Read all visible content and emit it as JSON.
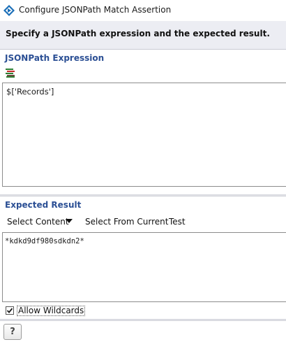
{
  "window": {
    "title": "Configure JSONPath Match Assertion",
    "app_icon": "app-logo-icon"
  },
  "header": {
    "instruction": "Specify a JSONPath expression and the expected result."
  },
  "expression_section": {
    "title": "JSONPath Expression",
    "toolbar_icon": "expression-builder-icon",
    "value": "$['Records']"
  },
  "result_section": {
    "title": "Expected Result",
    "toolbar": {
      "select_content": "Select Content",
      "select_from_current": "Select From Current",
      "test": "Test"
    },
    "value": "*kdkd9df980sdkdn2*",
    "allow_wildcards": {
      "label": "Allow Wildcards",
      "checked": true
    }
  },
  "footer": {
    "help_label": "?"
  },
  "colors": {
    "section_title": "#2b4f94",
    "header_band": "#ecedf3"
  }
}
